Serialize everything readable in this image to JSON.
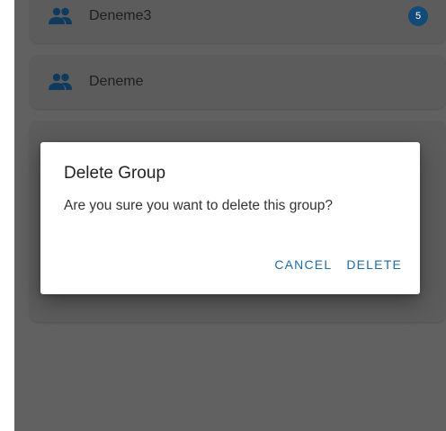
{
  "groups": [
    {
      "name": "Deneme3",
      "badge": "5",
      "icon": "group-icon"
    },
    {
      "name": "Deneme",
      "icon": "group-icon"
    },
    {
      "name": "",
      "icon": "group-icon"
    }
  ],
  "dialog": {
    "title": "Delete Group",
    "message": "Are you sure you want to delete this group?",
    "cancel_label": "CANCEL",
    "delete_label": "DELETE"
  },
  "colors": {
    "scrim": "#616161",
    "icon_muted": "#0f3a5e",
    "badge": "#124a78",
    "accent": "#1f6aa8"
  }
}
